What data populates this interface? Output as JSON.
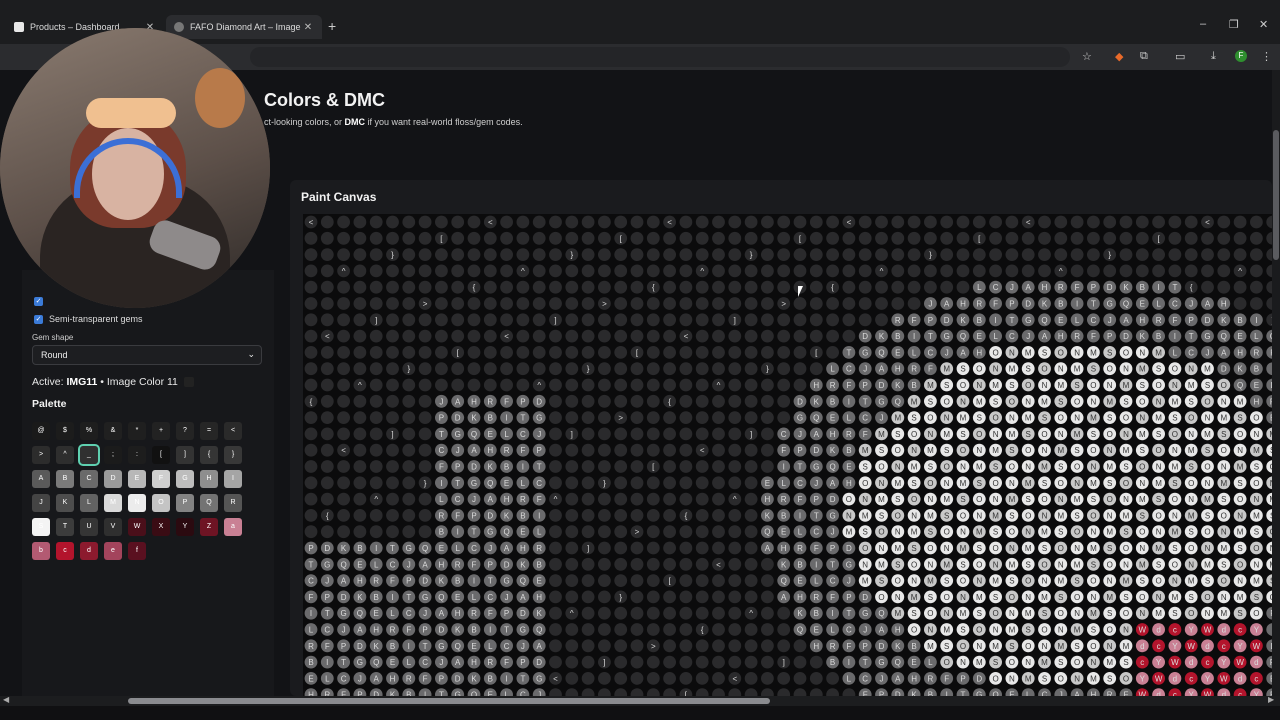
{
  "browser": {
    "tabs": [
      {
        "title": "Products – Dashboard",
        "active": false
      },
      {
        "title": "FAFO Diamond Art – Image Col",
        "active": true
      }
    ],
    "new_tab": "+",
    "window_controls": {
      "minimize": "–",
      "maximize": "❐",
      "close": "✕"
    },
    "toolbar_icons": [
      "star-icon",
      "extension-fox-icon",
      "puzzle-icon",
      "cast-icon",
      "download-icon",
      "profile-avatar",
      "menu-icon"
    ],
    "avatar_letter": "F"
  },
  "page": {
    "heading": "Colors & DMC",
    "sub_pre": "ct-looking colors, or ",
    "sub_bold": "DMC",
    "sub_post": " if you want real-world floss/gem codes."
  },
  "sidebar": {
    "semi_transparent_label": "Semi-transparent gems",
    "gem_shape_label": "Gem shape",
    "gem_shape_value": "Round",
    "active_prefix": "Active: ",
    "active_code": "IMG11",
    "active_suffix": " • Image Color 11",
    "palette_title": "Palette",
    "palette": [
      {
        "sym": "@",
        "color": "#1a1a1a"
      },
      {
        "sym": "$",
        "color": "#1c1c1c"
      },
      {
        "sym": "%",
        "color": "#1e1e1e"
      },
      {
        "sym": "&",
        "color": "#202020"
      },
      {
        "sym": "*",
        "color": "#1f1f1f"
      },
      {
        "sym": "+",
        "color": "#222222"
      },
      {
        "sym": "?",
        "color": "#242424"
      },
      {
        "sym": "=",
        "color": "#262626"
      },
      {
        "sym": "<",
        "color": "#2a2a2a"
      },
      {
        "sym": ">",
        "color": "#2c2c2c"
      },
      {
        "sym": "^",
        "color": "#2e2e2e"
      },
      {
        "sym": "_",
        "color": "#303030"
      },
      {
        "sym": ";",
        "color": "#1b1b1b"
      },
      {
        "sym": ":",
        "color": "#1d1d1d"
      },
      {
        "sym": "[",
        "color": "#111111"
      },
      {
        "sym": "]",
        "color": "#333333"
      },
      {
        "sym": "{",
        "color": "#353535"
      },
      {
        "sym": "}",
        "color": "#383838"
      },
      {
        "sym": "A",
        "color": "#5a5a5a"
      },
      {
        "sym": "B",
        "color": "#7a7a7a"
      },
      {
        "sym": "C",
        "color": "#6a6a6a"
      },
      {
        "sym": "D",
        "color": "#9a9a9a"
      },
      {
        "sym": "E",
        "color": "#b8b8b8"
      },
      {
        "sym": "F",
        "color": "#cfcfcf"
      },
      {
        "sym": "G",
        "color": "#bdbdbd"
      },
      {
        "sym": "H",
        "color": "#8e8e8e"
      },
      {
        "sym": "I",
        "color": "#a5a5a5"
      },
      {
        "sym": "J",
        "color": "#444444"
      },
      {
        "sym": "K",
        "color": "#4d4d4d"
      },
      {
        "sym": "L",
        "color": "#626262"
      },
      {
        "sym": "M",
        "color": "#d9d9d9"
      },
      {
        "sym": "N",
        "color": "#ececec"
      },
      {
        "sym": "O",
        "color": "#c4c4c4"
      },
      {
        "sym": "P",
        "color": "#838383"
      },
      {
        "sym": "Q",
        "color": "#737373"
      },
      {
        "sym": "R",
        "color": "#555555"
      },
      {
        "sym": "S",
        "color": "#f4f4f4"
      },
      {
        "sym": "T",
        "color": "#3c3c3c"
      },
      {
        "sym": "U",
        "color": "#353535"
      },
      {
        "sym": "V",
        "color": "#2f2f2f"
      },
      {
        "sym": "W",
        "color": "#4a0f1a"
      },
      {
        "sym": "X",
        "color": "#3a0c14"
      },
      {
        "sym": "Y",
        "color": "#2b0a10"
      },
      {
        "sym": "Z",
        "color": "#6e1424"
      },
      {
        "sym": "a",
        "color": "#c98094"
      },
      {
        "sym": "b",
        "color": "#b35a72"
      },
      {
        "sym": "c",
        "color": "#b3142c"
      },
      {
        "sym": "d",
        "color": "#8c1a2e"
      },
      {
        "sym": "e",
        "color": "#a3445c"
      },
      {
        "sym": "f",
        "color": "#5a1020"
      }
    ],
    "selected_symbol": "_"
  },
  "canvas": {
    "title": "Paint Canvas",
    "colors": {
      "background": "#0b0b0c",
      "dark_gem": "#2a2a2c",
      "mid_gem": "#6a6a6c",
      "light_gem": "#c8c8c8",
      "bright_gem": "#e8e8e8",
      "red_gem": "#b3142c",
      "pink_gem": "#c98094"
    }
  }
}
